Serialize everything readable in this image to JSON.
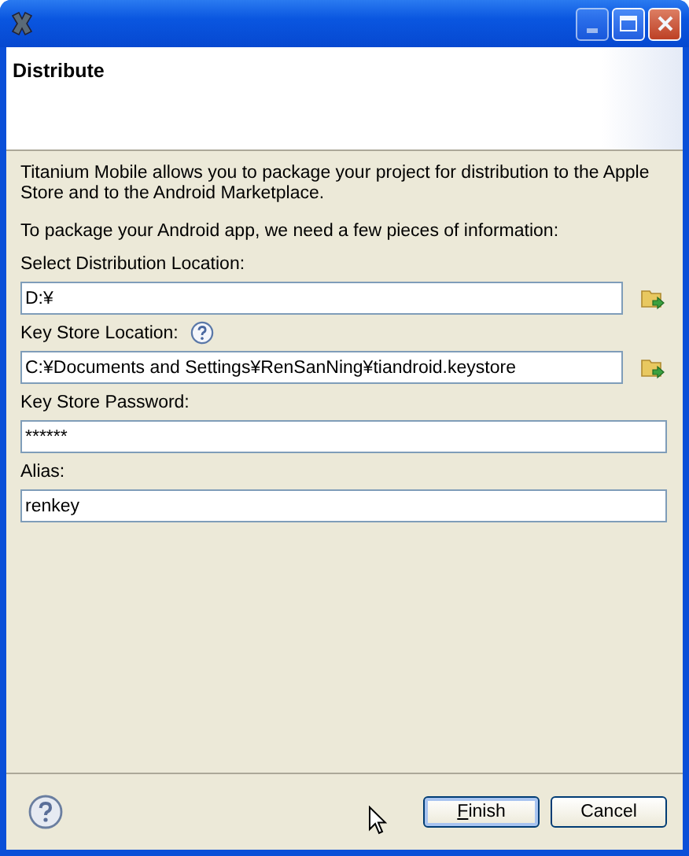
{
  "header": {
    "title": "Distribute"
  },
  "intro": [
    "Titanium Mobile allows you to package your project for distribution to the Apple Store and to the Android Marketplace.",
    "To package your Android app, we need a few pieces of information:"
  ],
  "fields": [
    {
      "kind": "browse",
      "label": "Select Distribution Location:",
      "value": "D:¥",
      "help": false
    },
    {
      "kind": "browse",
      "label": "Key Store Location:",
      "value": "C:¥Documents and Settings¥RenSanNing¥tiandroid.keystore",
      "help": true
    },
    {
      "kind": "text",
      "label": "Key Store Password:",
      "value": "******",
      "help": false
    },
    {
      "kind": "text",
      "label": "Alias:",
      "value": "renkey",
      "help": false
    }
  ],
  "buttons": [
    {
      "label": "Finish",
      "mnemonic": true,
      "default": true
    },
    {
      "label": "Cancel",
      "mnemonic": false,
      "default": false
    }
  ]
}
